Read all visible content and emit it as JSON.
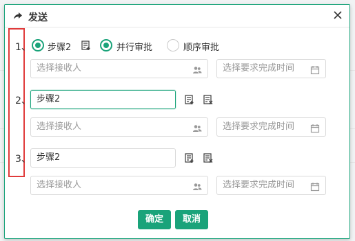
{
  "dialog": {
    "title": "发送",
    "title_icon": "share-arrow-icon",
    "close_icon": "close-icon"
  },
  "step1": {
    "num": "1、",
    "step_radio_label": "步骤2",
    "parallel_label": "并行审批",
    "sequential_label": "顺序审批",
    "selected_mode": "并行审批",
    "receiver_placeholder": "选择接收人",
    "time_placeholder": "选择要求完成时间"
  },
  "step2": {
    "num": "2、",
    "name_value": "步骤2",
    "receiver_placeholder": "选择接收人",
    "time_placeholder": "选择要求完成时间"
  },
  "step3": {
    "num": "3、",
    "name_value": "步骤2",
    "receiver_placeholder": "选择接收人",
    "time_placeholder": "选择要求完成时间"
  },
  "footer": {
    "confirm_label": "确定",
    "cancel_label": "取消"
  },
  "colors": {
    "accent": "#1aa37a",
    "marker": "#e03a3a"
  }
}
